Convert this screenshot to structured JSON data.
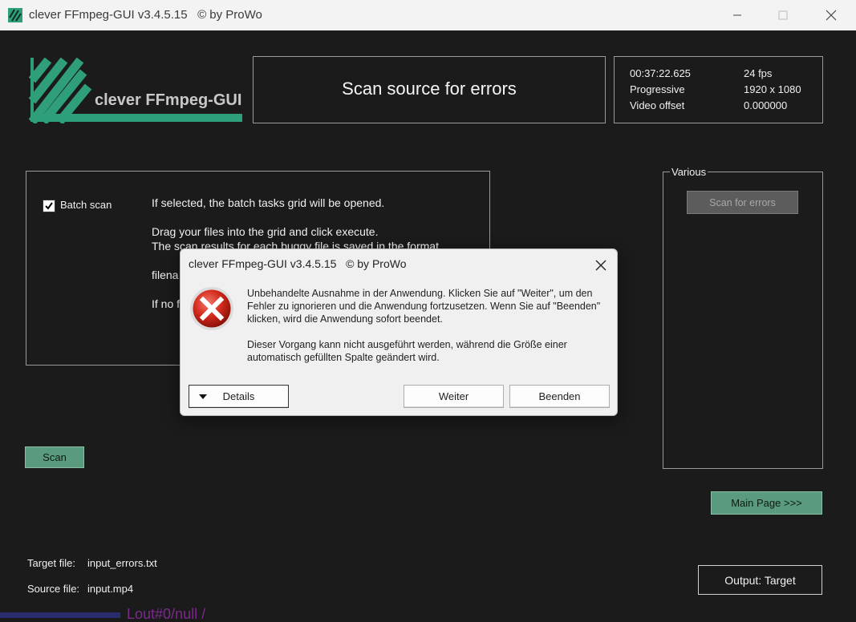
{
  "window": {
    "title": "clever FFmpeg-GUI v3.4.5.15   © by ProWo"
  },
  "logo": {
    "text": "clever FFmpeg-GUI",
    "color": "#2f9e7a"
  },
  "header": {
    "title": "Scan source for errors"
  },
  "info": {
    "duration": "00:37:22.625",
    "fps": "24 fps",
    "scan_type": "Progressive",
    "resolution": "1920 x 1080",
    "video_offset_label": "Video offset",
    "video_offset": "0.000000"
  },
  "options": {
    "batch_scan_label": "Batch scan",
    "batch_scan_checked": true,
    "line1": "If selected, the batch tasks grid will be opened.",
    "line2": "Drag your files into the grid and click execute.",
    "line3": "The scan results for each buggy file is saved in the format",
    "line4": "filena",
    "line5": "If no f"
  },
  "various": {
    "label": "Various",
    "scan_errors_button": "Scan for errors"
  },
  "buttons": {
    "scan": "Scan",
    "main_page": "Main Page >>>",
    "output_target": "Output: Target"
  },
  "files": {
    "target_label": "Target file:",
    "target_value": "input_errors.txt",
    "source_label": "Source file:",
    "source_value": "input.mp4"
  },
  "background_fragment": "Lout#0/null /",
  "dialog": {
    "title": "clever FFmpeg-GUI v3.4.5.15   © by ProWo",
    "message1": "Unbehandelte Ausnahme in der Anwendung. Klicken Sie auf \"Weiter\", um den Fehler zu ignorieren und die Anwendung fortzusetzen. Wenn Sie auf \"Beenden\" klicken, wird die Anwendung sofort beendet.",
    "message2": "Dieser Vorgang kann nicht ausgeführt werden, während die Größe einer automatisch gefüllten Spalte geändert wird.",
    "details_button": "Details",
    "continue_button": "Weiter",
    "quit_button": "Beenden"
  }
}
